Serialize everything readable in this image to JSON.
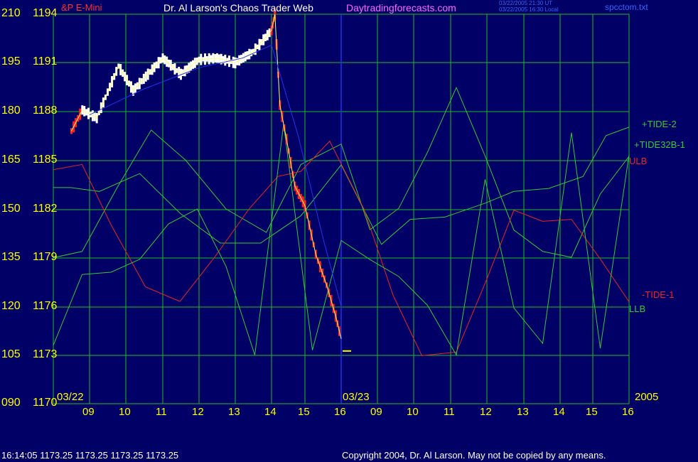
{
  "header": {
    "instrument": "&P E-Mini",
    "title": "Dr. Al Larson's Chaos Trader Web",
    "site": "Daytradingforecasts.com",
    "time_ut": "03/22/2005 21:30 UT",
    "time_local": "03/22/2005 16:30 Local",
    "file": "spcctom.txt"
  },
  "footer": {
    "status": "16:14:05  1173.25 1173.25 1173.25 1173.25",
    "copyright": "Copyright 2004, Dr. Al Larson. May not be copied by any means."
  },
  "colors": {
    "background": "#000066",
    "grid": "#22bb22",
    "price_up": "#ffffff",
    "price_down": "#ff2222",
    "tide_green": "#33cc33",
    "tide_red": "#ee2222",
    "ma_blue": "#2233ee",
    "axis_text": "#ffff00"
  },
  "chart_data": {
    "type": "line",
    "left_axis_labels": [
      "210",
      "195",
      "180",
      "165",
      "150",
      "135",
      "120",
      "105",
      "090"
    ],
    "price_axis_labels": [
      "1194",
      "1191",
      "1188",
      "1185",
      "1182",
      "1179",
      "1176",
      "1173",
      "1170"
    ],
    "price_range": [
      1170,
      1194
    ],
    "x_tick_labels": [
      "09",
      "10",
      "11",
      "12",
      "13",
      "14",
      "15",
      "16",
      "09",
      "10",
      "11",
      "12",
      "13",
      "14",
      "15",
      "16"
    ],
    "date_labels": [
      "03/22",
      "03/23",
      "2005"
    ],
    "legend": [
      "+TIDE-2",
      "+TIDE32B-1",
      "ULB",
      "-TIDE-1",
      "LLB"
    ],
    "last_price": 1173.25,
    "series": [
      {
        "name": "S&P E-Mini",
        "x_hours_day1": [
          8.5,
          8.8,
          9.2,
          9.5,
          9.8,
          10.2,
          10.6,
          11.0,
          11.5,
          12.0,
          12.5,
          13.0,
          13.5,
          14.0,
          14.1,
          14.25,
          14.45,
          14.7,
          15.0,
          15.3,
          15.6,
          15.85,
          16.0
        ],
        "y_price": [
          1186.8,
          1188.1,
          1187.6,
          1189.2,
          1190.8,
          1189.3,
          1190.3,
          1191.3,
          1190.3,
          1191.2,
          1191.3,
          1191.0,
          1191.7,
          1193.0,
          1194.0,
          1188.4,
          1186.3,
          1183.4,
          1182.2,
          1179.2,
          1177.3,
          1175.4,
          1174.0
        ]
      },
      {
        "name": "+TIDE-2",
        "x_position": [
          0.0,
          0.03,
          0.08,
          0.15,
          0.22,
          0.29,
          0.36,
          0.43,
          0.5,
          0.57,
          0.62,
          0.68,
          0.75,
          0.8,
          0.86,
          0.92,
          0.96,
          1.0
        ],
        "y_level": [
          156.6,
          156.6,
          155.4,
          160.9,
          148.7,
          139.5,
          139.5,
          147.9,
          163.6,
          139.1,
          146.8,
          147.5,
          151.8,
          155.4,
          156.3,
          160.0,
          172.6,
          175.2
        ]
      },
      {
        "name": "+TIDE32B-1",
        "x_position": [
          0.0,
          0.05,
          0.11,
          0.17,
          0.23,
          0.3,
          0.37,
          0.43,
          0.5,
          0.55,
          0.6,
          0.65,
          0.7,
          0.75,
          0.8,
          0.85,
          0.9,
          0.95,
          1.0
        ],
        "y_level": [
          135.0,
          136.9,
          156.3,
          174.3,
          165.0,
          150.0,
          142.8,
          163.7,
          170.0,
          143.6,
          150.2,
          167.5,
          187.4,
          166.3,
          143.5,
          136.9,
          135.1,
          154.6,
          166.2
        ]
      },
      {
        "name": "ULB / -TIDE-1",
        "x_position": [
          0.0,
          0.05,
          0.1,
          0.16,
          0.22,
          0.28,
          0.34,
          0.39,
          0.43,
          0.48,
          0.54,
          0.59,
          0.64,
          0.7,
          0.75,
          0.8,
          0.85,
          0.9,
          0.95,
          1.0
        ],
        "y_level": [
          162.1,
          163.7,
          145.2,
          126.0,
          121.5,
          135.1,
          150.0,
          160.0,
          161.6,
          170.9,
          149.8,
          123.5,
          104.8,
          105.9,
          127.1,
          149.6,
          146.2,
          146.8,
          134.6,
          121.4
        ]
      },
      {
        "name": "LLB",
        "x_position": [
          0.0,
          0.05,
          0.1,
          0.15,
          0.2,
          0.25,
          0.3,
          0.35,
          0.4,
          0.45,
          0.5,
          0.55,
          0.6,
          0.65,
          0.7,
          0.75,
          0.8,
          0.85,
          0.9,
          0.95,
          1.0
        ],
        "y_level": [
          108.0,
          129.8,
          130.5,
          134.5,
          145.4,
          150.0,
          132.3,
          105.0,
          176.2,
          106.5,
          140.3,
          134.4,
          129.2,
          120.3,
          105.0,
          159.1,
          119.5,
          108.6,
          173.5,
          107.1,
          166.7
        ]
      }
    ]
  }
}
